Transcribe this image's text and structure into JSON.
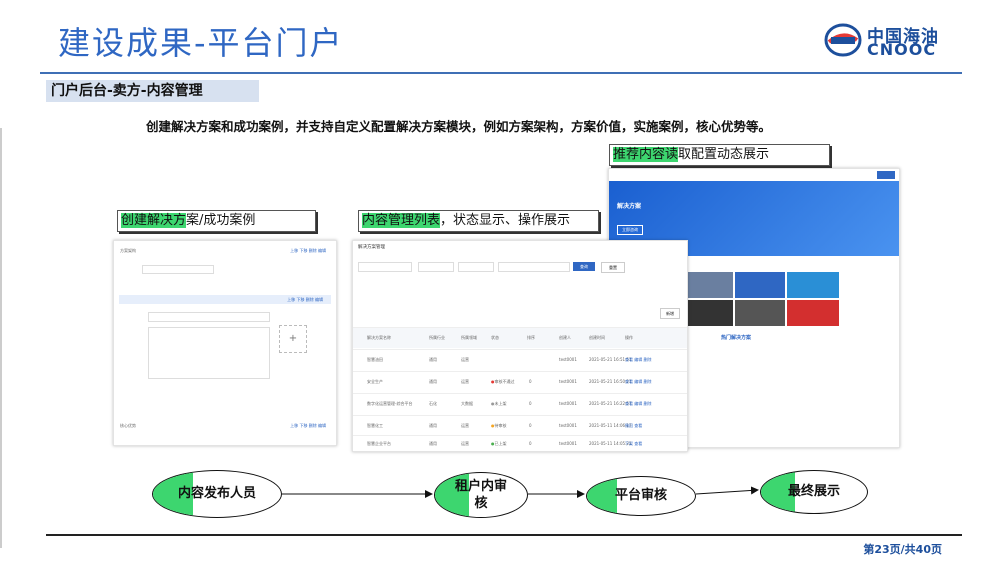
{
  "slide_title": "建设成果-平台门户",
  "logo": {
    "cn": "中国海油",
    "en": "CNOOC"
  },
  "section_title": "门户后台-卖方-内容管理",
  "description": "创建解决方案和成功案例，并支持自定义配置解决方案模块，例如方案架构，方案价值，实施案例，核心优势等。",
  "captions": {
    "create": {
      "highlight": "创建解决方",
      "rest": "案/成功案例"
    },
    "list": {
      "highlight": "内容管理列表",
      "rest": "，状态显示、操作展示"
    },
    "recommend": {
      "highlight": "推荐内容读",
      "rest": "取配置动态展示"
    }
  },
  "shot_list": {
    "title": "解决方案管理",
    "search_btn": "查询",
    "reset_btn": "重置",
    "add_btn": "新增",
    "headers": [
      "解决方案名称",
      "所属行业",
      "所属领域",
      "状态",
      "排序",
      "创建人",
      "创建时间",
      "操作"
    ],
    "rows": [
      {
        "name": "智慧油田",
        "industry": "通用",
        "domain": "运营",
        "status": "",
        "sort": "",
        "creator": "test0001",
        "time": "2021-05-21 16:51:51",
        "ops": "查看 编辑 删除"
      },
      {
        "name": "安全生产",
        "industry": "通用",
        "domain": "运营",
        "status": "审核不通过",
        "sort": "0",
        "creator": "test0001",
        "time": "2021-05-21 16:50:21",
        "ops": "查看 编辑 删除"
      },
      {
        "name": "数字化运营管理-综合平台",
        "industry": "石化",
        "domain": "大数据",
        "status": "未上架",
        "sort": "0",
        "creator": "test0001",
        "time": "2021-05-21 16:22:57",
        "ops": "查看 编辑 删除"
      },
      {
        "name": "智慧化工",
        "industry": "通用",
        "domain": "运营",
        "status": "待审核",
        "sort": "0",
        "creator": "test0001",
        "time": "2021-05-11 14:06:17",
        "ops": "撤回 查看"
      },
      {
        "name": "智慧企业平台",
        "industry": "通用",
        "domain": "运营",
        "status": "已上架",
        "sort": "0",
        "creator": "test0001",
        "time": "2021-05-11 14:05:22",
        "ops": "下架 查看"
      }
    ]
  },
  "shot_portal": {
    "banner_title": "解决方案",
    "section_title": "热门解决方案",
    "btn": "立即咨询"
  },
  "shot_form": {
    "section1": "方案架构",
    "section2": "核心优势",
    "add_label": "新增",
    "ops": "上移 下移 删除 编辑"
  },
  "flow": {
    "n1": "内容发布人员",
    "n2": "租户内审核",
    "n3": "平台审核",
    "n4": "最终展示"
  },
  "pager": "第23页/共40页",
  "colors": {
    "accent": "#2f67c3",
    "highlight": "#3dd66f",
    "status_red": "#e53935",
    "status_orange": "#f5a623",
    "status_green": "#4caf50"
  }
}
